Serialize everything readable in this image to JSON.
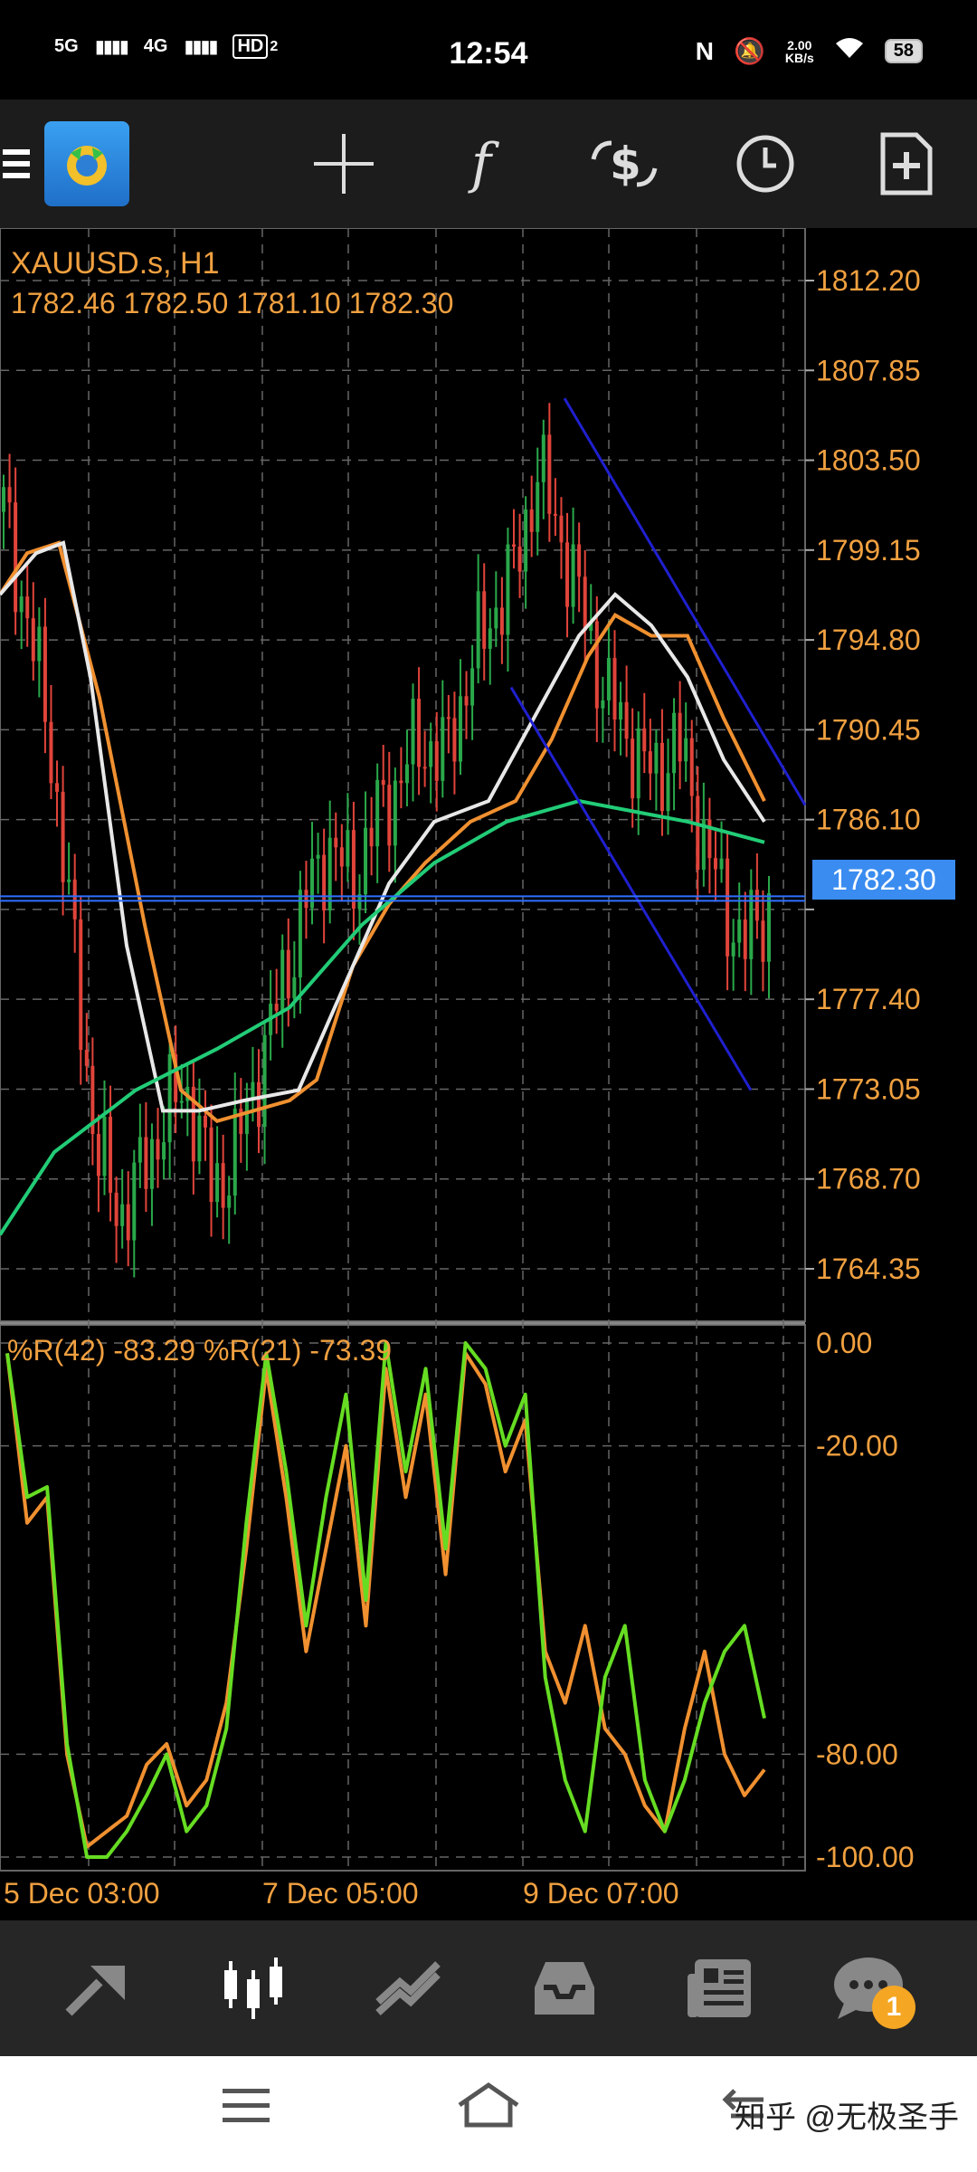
{
  "status_bar": {
    "time": "12:54",
    "net1": "5G",
    "net2": "4G",
    "hd": "HD",
    "hd_sub": "2",
    "nfc": "N",
    "speed_value": "2.00",
    "speed_unit": "KB/s",
    "battery": "58"
  },
  "toolbar": {
    "crosshair_icon": "crosshair-icon",
    "indicators_label": "f",
    "trade_icon": "trade-icon",
    "timeframe_icon": "clock-icon",
    "objects_icon": "add-document-icon"
  },
  "chart": {
    "symbol": "XAUUSD.s, H1",
    "ohlc": "1782.46 1782.50 1781.10 1782.30",
    "current_price": "1782.30",
    "price_ticks": [
      "1812.20",
      "1807.85",
      "1803.50",
      "1799.15",
      "1794.80",
      "1790.45",
      "1786.10",
      "1777.40",
      "1773.05",
      "1768.70",
      "1764.35"
    ],
    "indicator_label": "%R(42) -83.29 %R(21) -73.39",
    "indicator_ticks": [
      "0.00",
      "-20.00",
      "-80.00",
      "-100.00"
    ],
    "time_labels": [
      "5 Dec 03:00",
      "7 Dec 05:00",
      "9 Dec 07:00"
    ],
    "colors": {
      "axis": "#f0a040",
      "up": "#2aa84a",
      "down": "#e0443a",
      "white_ma": "#e8e8e8",
      "orange_ma": "#f09030",
      "green_ma": "#22cc77",
      "channel": "#2020d0",
      "price_line": "#3070ff",
      "wr42": "#f09030",
      "wr21": "#66dd22"
    }
  },
  "chart_data": {
    "type": "line",
    "title": "XAUUSD.s, H1",
    "ylim": [
      1762,
      1814
    ],
    "ticks": [
      1812.2,
      1807.85,
      1803.5,
      1799.15,
      1794.8,
      1790.45,
      1786.1,
      1781.75,
      1777.4,
      1773.05,
      1768.7,
      1764.35
    ],
    "x_labels": [
      "5 Dec 03:00",
      "7 Dec 05:00",
      "9 Dec 07:00"
    ],
    "last_price": 1782.3,
    "series": [
      {
        "name": "%R(42)",
        "values": [
          -2,
          -35,
          -30,
          -80,
          -98,
          -95,
          -92,
          -82,
          -78,
          -90,
          -85,
          -70,
          -40,
          -5,
          -30,
          -60,
          -40,
          -20,
          -55,
          -5,
          -30,
          -10,
          -45,
          -2,
          -8,
          -25,
          -15,
          -60,
          -70,
          -55,
          -75,
          -80,
          -90,
          -95,
          -75,
          -60,
          -80,
          -88,
          -83
        ]
      },
      {
        "name": "%R(21)",
        "values": [
          -2,
          -30,
          -28,
          -78,
          -100,
          -100,
          -95,
          -88,
          -80,
          -95,
          -90,
          -75,
          -35,
          -2,
          -25,
          -55,
          -30,
          -10,
          -50,
          0,
          -25,
          -5,
          -40,
          0,
          -5,
          -20,
          -10,
          -65,
          -85,
          -95,
          -65,
          -55,
          -85,
          -95,
          -85,
          -70,
          -60,
          -55,
          -73
        ]
      }
    ]
  },
  "bottom_nav": {
    "items": [
      "quotes-icon",
      "chart-icon",
      "trade-icon",
      "history-icon",
      "news-icon",
      "messages-icon"
    ],
    "badge": "1"
  },
  "system_nav": {
    "watermark": "知乎 @无极圣手"
  }
}
